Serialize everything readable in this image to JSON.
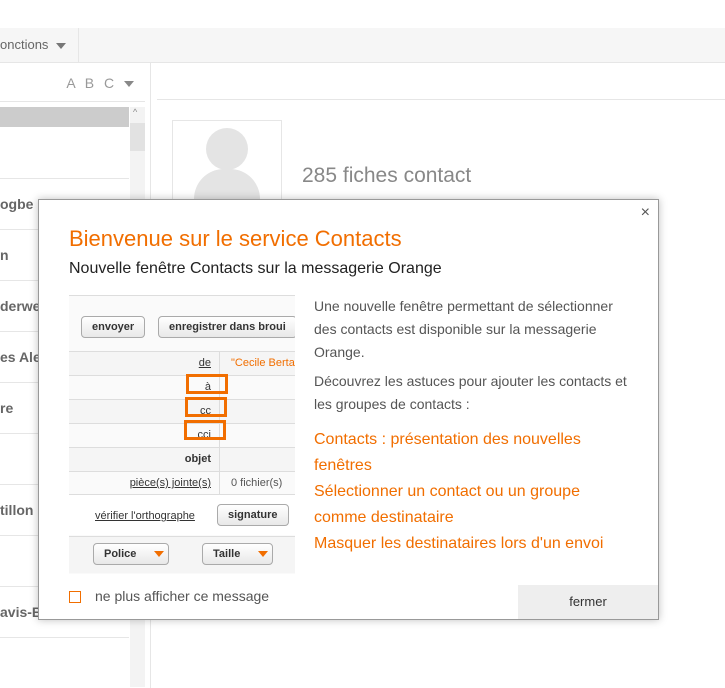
{
  "toolbar": {
    "functions_label": "onctions"
  },
  "left": {
    "sort_label": "A B C",
    "items": [
      "",
      "ogbe",
      "n",
      "derwe",
      "es Ale",
      "re",
      "",
      "tillon",
      "",
      "avis-B"
    ]
  },
  "main": {
    "count": "285 fiches contact"
  },
  "modal": {
    "title": "Bienvenue sur le service Contacts",
    "subtitle": "Nouvelle fenêtre Contacts sur la messagerie Orange",
    "screenshot": {
      "send": "envoyer",
      "draft": "enregistrer dans broui",
      "de": "de",
      "de_value": "\"Cecile Berta",
      "a": "à",
      "cc": "cc",
      "cci": "cci",
      "objet": "objet",
      "attach": "pièce(s) jointe(s)",
      "attach_value": "0 fichier(s)",
      "spell": "vérifier l'orthographe",
      "signature": "signature",
      "font": "Police",
      "size": "Taille"
    },
    "text1": "Une nouvelle fenêtre permettant de sélectionner des contacts est disponible sur la messagerie Orange.",
    "text2": "Découvrez les astuces pour ajouter les contacts et les groupes de contacts :",
    "links": [
      "Contacts : présentation des nouvelles fenêtres",
      "Sélectionner un contact ou un groupe comme destinataire",
      "Masquer les destinataires lors d'un envoi"
    ],
    "checkbox_label": "ne plus afficher ce message",
    "close_button": "fermer",
    "close_icon": "×"
  }
}
